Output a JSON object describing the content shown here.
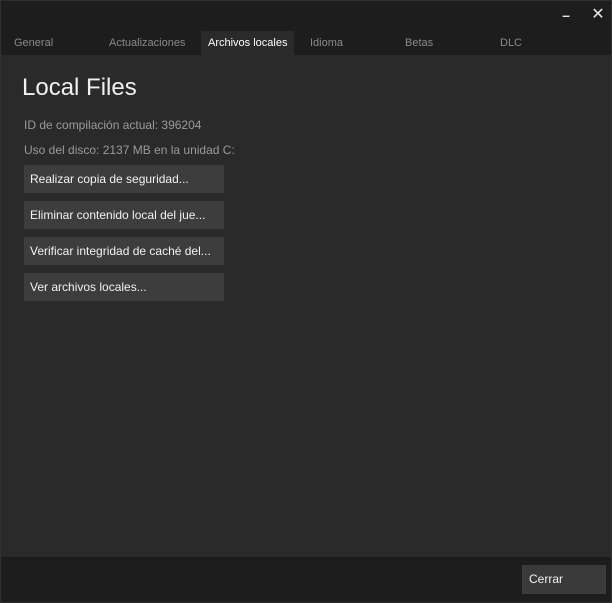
{
  "window": {
    "minimize_glyph": "–",
    "close_glyph": "✕"
  },
  "tabs": [
    {
      "label": "General"
    },
    {
      "label": "Actualizaciones"
    },
    {
      "label": "Archivos locales",
      "active": true
    },
    {
      "label": "Idioma"
    },
    {
      "label": "Betas"
    },
    {
      "label": "DLC"
    }
  ],
  "content": {
    "title": "Local Files",
    "build_id": "ID de compilación actual: 396204",
    "disk_usage": "Uso del disco: 2137 MB en la unidad C:",
    "buttons": [
      {
        "label": "Realizar copia de seguridad..."
      },
      {
        "label": "Eliminar contenido local del jue..."
      },
      {
        "label": "Verificar integridad de caché del..."
      },
      {
        "label": "Ver archivos locales..."
      }
    ]
  },
  "footer": {
    "close_label": "Cerrar"
  },
  "colors": {
    "background": "#1d1d1d",
    "panel": "#2a2a2a",
    "button": "#3d3d3d",
    "text": "#f0f0f0",
    "muted": "#9a9a9a"
  }
}
